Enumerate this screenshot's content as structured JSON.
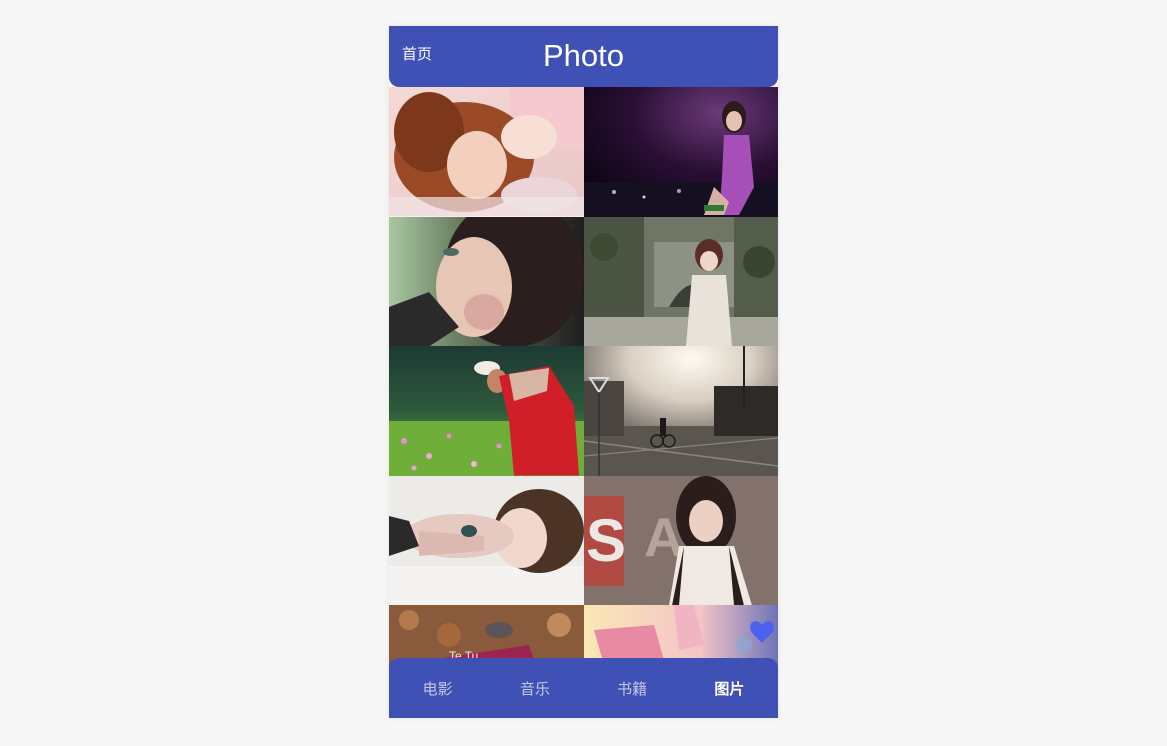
{
  "header": {
    "home_label": "首页",
    "title": "Photo"
  },
  "colors": {
    "primary": "#3f51b5",
    "tab_inactive": "#c6c9e6",
    "tab_active": "#ffffff",
    "page_background": "#f7f7f8"
  },
  "photos": [
    {
      "subject": "girl lying on pink bedding with curly auburn hair"
    },
    {
      "subject": "girl in purple dress at night"
    },
    {
      "subject": "close-up girl with dark hair and hand near face"
    },
    {
      "subject": "girl standing under stone arch in forest"
    },
    {
      "subject": "girl in red skirt picking flowers in meadow"
    },
    {
      "subject": "cyclist on sunlit street in sepia tone"
    },
    {
      "subject": "girl lying down with brown hair, bright background"
    },
    {
      "subject": "girl in white dress in front of letters S A"
    },
    {
      "subject": "person lying on autumn leaves"
    },
    {
      "subject": "pastel scene with pink fabric and blue heart"
    }
  ],
  "tabs": [
    {
      "label": "电影",
      "active": false
    },
    {
      "label": "音乐",
      "active": false
    },
    {
      "label": "书籍",
      "active": false
    },
    {
      "label": "图片",
      "active": true
    }
  ]
}
